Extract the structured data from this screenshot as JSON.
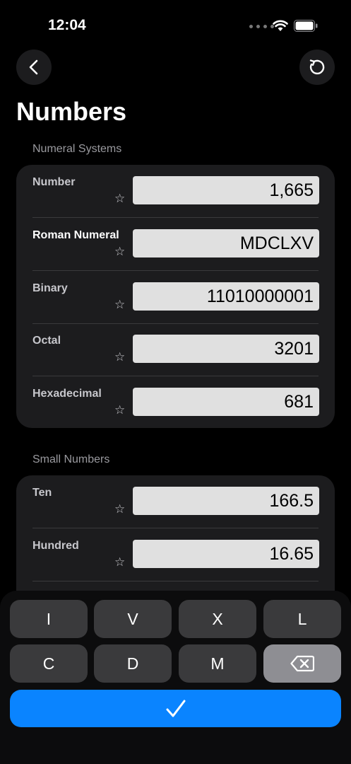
{
  "status_bar": {
    "time": "12:04"
  },
  "page_title": "Numbers",
  "sections": [
    {
      "label": "Numeral Systems",
      "rows": [
        {
          "label": "Number",
          "value": "1,665"
        },
        {
          "label": "Roman Numeral",
          "value": "MDCLXV"
        },
        {
          "label": "Binary",
          "value": "11010000001"
        },
        {
          "label": "Octal",
          "value": "3201"
        },
        {
          "label": "Hexadecimal",
          "value": "681"
        }
      ]
    },
    {
      "label": "Small Numbers",
      "rows": [
        {
          "label": "Ten",
          "value": "166.5"
        },
        {
          "label": "Hundred",
          "value": "16.65"
        }
      ]
    }
  ],
  "keyboard": {
    "keys": [
      "I",
      "V",
      "X",
      "L",
      "C",
      "D",
      "M"
    ],
    "delete_icon": "delete-backward-icon",
    "done_icon": "checkmark-icon"
  },
  "icons": {
    "star": "☆",
    "back": "chevron-left-icon",
    "reset": "reset-icon"
  },
  "colors": {
    "accent": "#0a84ff",
    "card": "#1c1c1e",
    "field": "#e0e0e0"
  }
}
